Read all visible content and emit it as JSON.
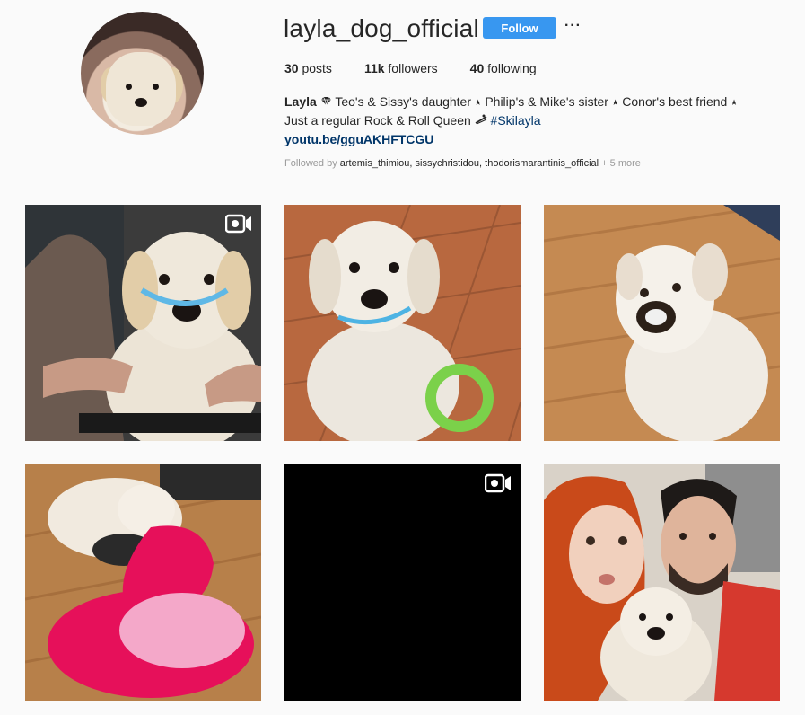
{
  "profile": {
    "username": "layla_dog_official",
    "follow_label": "Follow",
    "more_label": "···",
    "stats": {
      "posts_value": "30",
      "posts_label": "posts",
      "followers_value": "11k",
      "followers_label": "followers",
      "following_value": "40",
      "following_label": "following"
    },
    "bio": {
      "name": "Layla",
      "line1": "Teo's & Sissy's daughter ⭑ Philip's & Mike's sister ⭑ Conor's best friend ⭑",
      "line2": "Just a regular Rock & Roll Queen",
      "hashtag": "#Skilayla",
      "link": "youtu.be/gguAKHFTCGU"
    },
    "followed_by": {
      "prefix": "Followed by",
      "names": "artemis_thimiou, sissychristidou, thodorismarantinis_official",
      "suffix": "+ 5 more"
    }
  },
  "posts": [
    {
      "id": "post-1",
      "is_video": true
    },
    {
      "id": "post-2",
      "is_video": false
    },
    {
      "id": "post-3",
      "is_video": false
    },
    {
      "id": "post-4",
      "is_video": false
    },
    {
      "id": "post-5",
      "is_video": true
    },
    {
      "id": "post-6",
      "is_video": false
    }
  ],
  "colors": {
    "follow_button": "#3897f0",
    "link": "#003569",
    "muted": "#999999"
  }
}
